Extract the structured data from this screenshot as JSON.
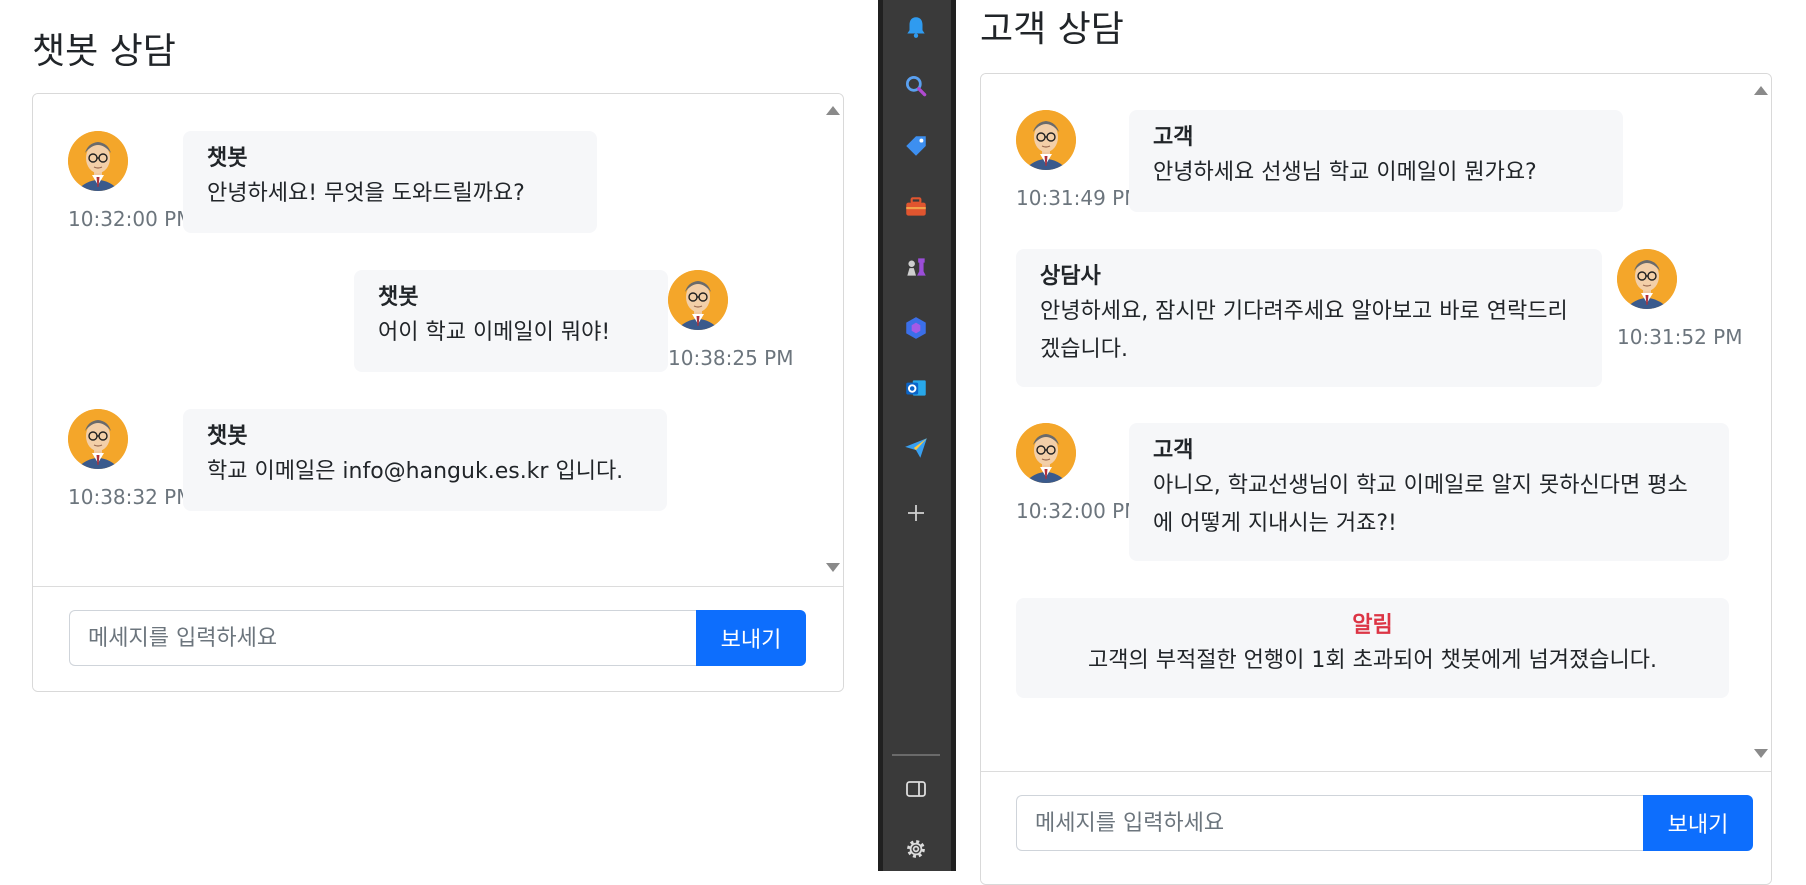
{
  "chatbot_panel": {
    "title": "챗봇 상담",
    "messages": [
      {
        "sender": "챗봇",
        "text": "안녕하세요! 무엇을 도와드릴까요?",
        "time": "10:32:00 PM"
      },
      {
        "sender": "챗봇",
        "text": "어이 학교 이메일이 뭐야!",
        "time": "10:38:25 PM"
      },
      {
        "sender": "챗봇",
        "text": "학교 이메일은 info@hanguk.es.kr 입니다.",
        "time": "10:38:32 PM"
      }
    ],
    "input_placeholder": "메세지를 입력하세요",
    "send_label": "보내기"
  },
  "customer_panel": {
    "title": "고객 상담",
    "messages": [
      {
        "sender": "고객",
        "text": "안녕하세요 선생님 학교 이메일이 뭔가요?",
        "time": "10:31:49 PM"
      },
      {
        "sender": "상담사",
        "text": "안녕하세요, 잠시만 기다려주세요 알아보고 바로 연락드리겠습니다.",
        "time": "10:31:52 PM"
      },
      {
        "sender": "고객",
        "text": "아니오, 학교선생님이 학교 이메일로 알지 못하신다면 평소에 어떻게 지내시는 거죠?!",
        "time": "10:32:00 PM"
      }
    ],
    "notice": {
      "title": "알림",
      "text": "고객의 부적절한 언행이 1회 초과되어 챗봇에게 넘겨졌습니다."
    },
    "input_placeholder": "메세지를 입력하세요",
    "send_label": "보내기"
  },
  "sidebar": {
    "icons": [
      "bell-icon",
      "search-icon",
      "tag-icon",
      "toolbox-icon",
      "chess-icon",
      "copilot-icon",
      "outlook-icon",
      "send-icon",
      "plus-icon",
      "sidebar-toggle-icon",
      "gear-icon"
    ]
  },
  "colors": {
    "accent": "#0d6efd",
    "notice_title": "#dc3545",
    "bubble_bg": "#f6f7f9",
    "sidebar_bg": "#3a3a3a"
  }
}
